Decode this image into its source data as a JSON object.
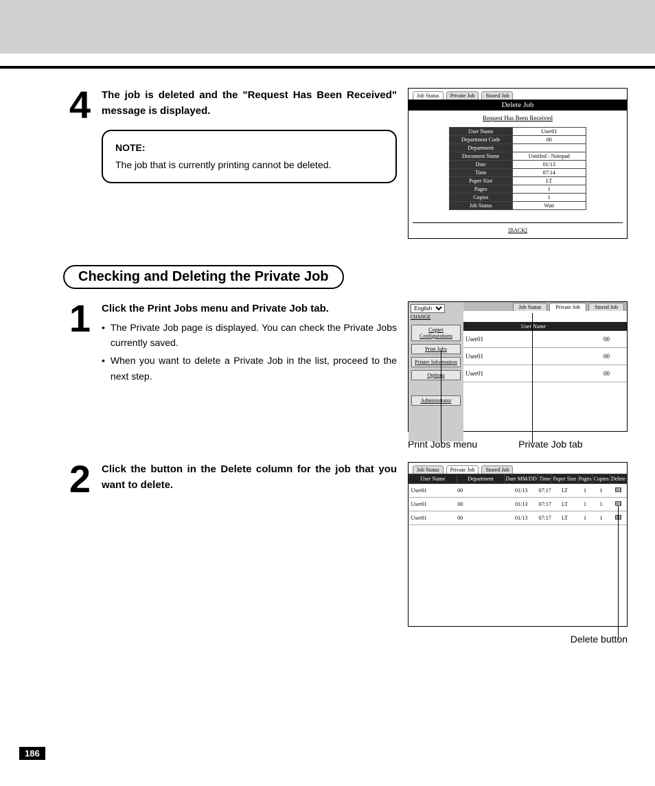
{
  "step4": {
    "number": "4",
    "title": "The job is deleted and the \"Request Has Been Received\" message is displayed.",
    "note_label": "NOTE:",
    "note_body": "The job that is currently printing cannot be deleted."
  },
  "shot1": {
    "tabs": {
      "t1": "Job Status",
      "t2": "Private Job",
      "t3": "Stored Job"
    },
    "title": "Delete Job",
    "msg": "Request Has Been Received",
    "rows": {
      "user_name_k": "User Name",
      "user_name_v": "User01",
      "dept_code_k": "Department Code",
      "dept_code_v": "00",
      "dept_k": "Department",
      "dept_v": "",
      "doc_k": "Document Name",
      "doc_v": "Untitled - Notepad",
      "date_k": "Date",
      "date_v": "01/13",
      "time_k": "Time",
      "time_v": "07:14",
      "paper_k": "Paper Size",
      "paper_v": "LT",
      "pages_k": "Pages",
      "pages_v": "1",
      "copies_k": "Copies",
      "copies_v": "1",
      "status_k": "Job Status",
      "status_v": "Wait"
    },
    "back": "[BACK]"
  },
  "section_title": "Checking and Deleting the Private Job",
  "step1": {
    "number": "1",
    "title": "Click the Print Jobs menu and Private Job tab.",
    "b1": "The Private Job page is displayed.  You can check the Private Jobs currently saved.",
    "b2": "When you want to delete a Private Job in the list, proceed to the next step."
  },
  "shot2": {
    "lang": "English",
    "change": "CHANGE",
    "side": {
      "copier": "Copier Configurations",
      "print": "Print Jobs",
      "info": "Printer Information",
      "options": "Options",
      "admin": "Administrator"
    },
    "tabs": {
      "t1": "Job Status",
      "t2": "Private Job",
      "t3": "Stored Job"
    },
    "hdr_user": "User Name",
    "rows": {
      "r1u": "User01",
      "r1d": "00",
      "r2u": "User01",
      "r2d": "00",
      "r3u": "User01",
      "r3d": "00"
    },
    "callout_left": "Print Jobs menu",
    "callout_right": "Private Job tab"
  },
  "step2": {
    "number": "2",
    "title": "Click the button in the Delete column for the job that you want to delete."
  },
  "shot3": {
    "tabs": {
      "t1": "Job Status",
      "t2": "Private Job",
      "t3": "Stored Job"
    },
    "headers": {
      "user": "User Name",
      "dept": "Department",
      "date": "Date MM/DD",
      "time": "Time",
      "paper": "Paper Size",
      "pages": "Pages",
      "copies": "Copies",
      "delete": "Delete"
    },
    "rows": [
      {
        "user": "User01",
        "dept": "00",
        "date": "01/13",
        "time": "07:17",
        "paper": "LT",
        "pages": "1",
        "copies": "1"
      },
      {
        "user": "User01",
        "dept": "00",
        "date": "01/13",
        "time": "07:17",
        "paper": "LT",
        "pages": "1",
        "copies": "1"
      },
      {
        "user": "User01",
        "dept": "00",
        "date": "01/13",
        "time": "07:17",
        "paper": "LT",
        "pages": "1",
        "copies": "1"
      }
    ],
    "callout": "Delete button"
  },
  "page_number": "186"
}
